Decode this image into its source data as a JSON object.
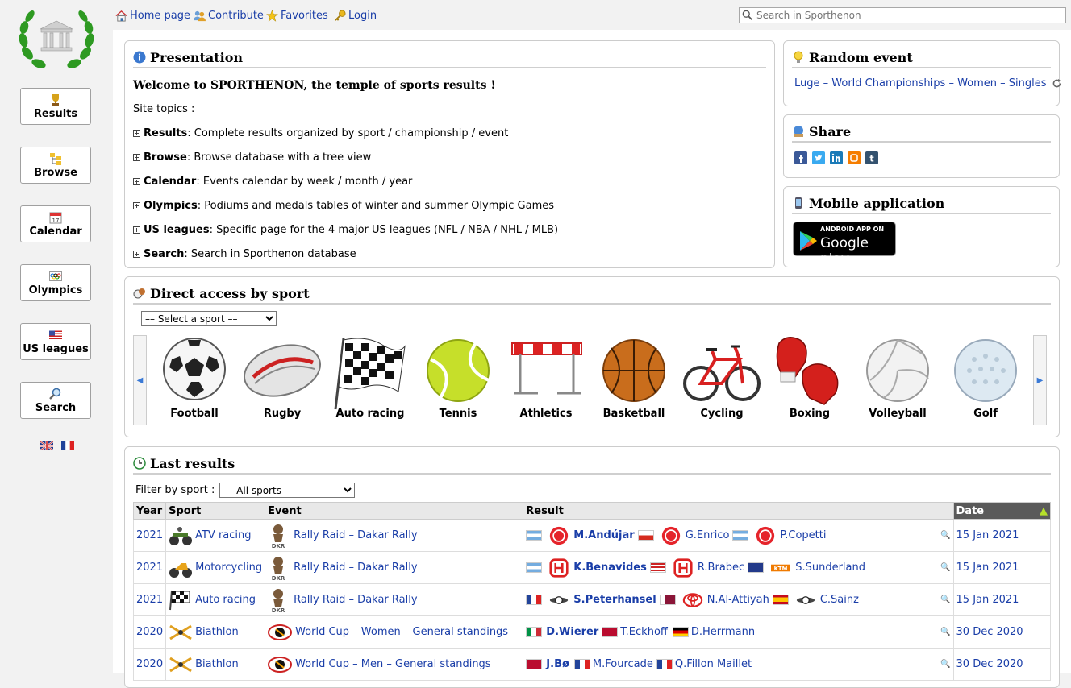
{
  "nav": {
    "home": "Home page",
    "contribute": "Contribute",
    "favorites": "Favorites",
    "login": "Login",
    "search_placeholder": "Search in Sporthenon"
  },
  "sidebar": {
    "items": [
      {
        "label": "Results",
        "icon": "trophy-icon"
      },
      {
        "label": "Browse",
        "icon": "tree-icon"
      },
      {
        "label": "Calendar",
        "icon": "calendar-icon"
      },
      {
        "label": "Olympics",
        "icon": "olympic-rings-icon"
      },
      {
        "label": "US leagues",
        "icon": "us-flag-icon"
      },
      {
        "label": "Search",
        "icon": "magnifier-icon"
      }
    ]
  },
  "presentation": {
    "title": "Presentation",
    "welcome": "Welcome to SPORTHENON, the temple of sports results !",
    "site_topics": "Site topics :",
    "topics": [
      {
        "name": "Results",
        "desc": " : Complete results organized by sport / championship / event"
      },
      {
        "name": "Browse",
        "desc": " : Browse database with a tree view"
      },
      {
        "name": "Calendar",
        "desc": " : Events calendar by week / month / year"
      },
      {
        "name": "Olympics",
        "desc": " : Podiums and medals tables of winter and summer Olympic Games"
      },
      {
        "name": "US leagues",
        "desc": " : Specific page for the 4 major US leagues (NFL / NBA / NHL / MLB)"
      },
      {
        "name": "Search",
        "desc": " : Search in Sporthenon database"
      }
    ]
  },
  "random_event": {
    "title": "Random event",
    "link": "Luge – World Championships – Women – Singles"
  },
  "share": {
    "title": "Share"
  },
  "mobile": {
    "title": "Mobile application",
    "badge_top": "ANDROID APP ON",
    "badge_main": "Google play"
  },
  "direct_access": {
    "title": "Direct access by sport",
    "select_value": "–– Select a sport ––",
    "sports": [
      "Football",
      "Rugby",
      "Auto racing",
      "Tennis",
      "Athletics",
      "Basketball",
      "Cycling",
      "Boxing",
      "Volleyball",
      "Golf"
    ]
  },
  "last_results": {
    "title": "Last results",
    "filter_label": "Filter by sport :",
    "filter_value": "–– All sports ––",
    "columns": [
      "Year",
      "Sport",
      "Event",
      "Result",
      "Date"
    ],
    "rows": [
      {
        "year": "2021",
        "sport": "ATV racing",
        "event": "Rally Raid – Dakar Rally",
        "r1": "M.Andújar",
        "r2": "G.Enrico",
        "r3": "P.Copetti",
        "date": "15 Jan 2021"
      },
      {
        "year": "2021",
        "sport": "Motorcycling",
        "event": "Rally Raid – Dakar Rally",
        "r1": "K.Benavides",
        "r2": "R.Brabec",
        "r3": "S.Sunderland",
        "date": "15 Jan 2021"
      },
      {
        "year": "2021",
        "sport": "Auto racing",
        "event": "Rally Raid – Dakar Rally",
        "r1": "S.Peterhansel",
        "r2": "N.Al-Attiyah",
        "r3": "C.Sainz",
        "date": "15 Jan 2021"
      },
      {
        "year": "2020",
        "sport": "Biathlon",
        "event": "World Cup – Women – General standings",
        "r1": "D.Wierer",
        "r2": "T.Eckhoff",
        "r3": "D.Herrmann",
        "date": "30 Dec 2020"
      },
      {
        "year": "2020",
        "sport": "Biathlon",
        "event": "World Cup – Men – General standings",
        "r1": "J.Bø",
        "r2": "M.Fourcade",
        "r3": "Q.Fillon Maillet",
        "date": "30 Dec 2020"
      }
    ]
  },
  "colors": {
    "link": "#1a3ea8",
    "date_header": "#5a5a5a",
    "laurel": "#2e8b22"
  }
}
